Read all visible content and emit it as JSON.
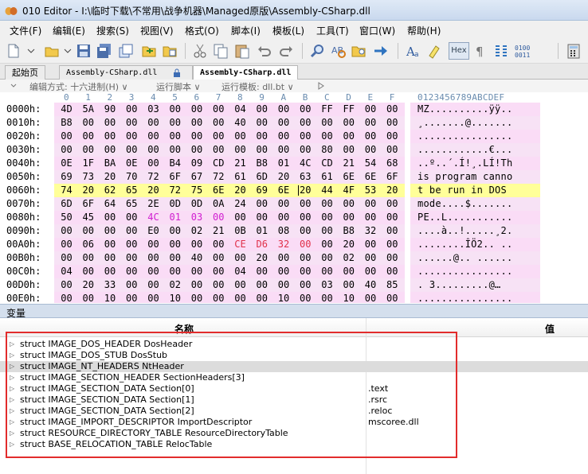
{
  "window": {
    "title": "010 Editor - I:\\临时下载\\不常用\\战争机器\\Managed原版\\Assembly-CSharp.dll"
  },
  "menu": [
    "文件(F)",
    "编辑(E)",
    "搜索(S)",
    "视图(V)",
    "格式(O)",
    "脚本(I)",
    "模板(L)",
    "工具(T)",
    "窗口(W)",
    "帮助(H)"
  ],
  "toolbar": {
    "icons": [
      "new-file-icon",
      "open-file-icon",
      "save-icon",
      "save-all-icon",
      "copy-window-icon",
      "open-folder-icon",
      "cut-icon",
      "copy-icon",
      "paste-icon",
      "undo-icon",
      "redo-icon",
      "find-icon",
      "replace-icon",
      "find-in-files-icon",
      "goto-icon",
      "font-icon",
      "highlight-icon",
      "hex-icon",
      "paragraph-icon",
      "columns-icon",
      "binary-icon",
      "calculator-icon"
    ],
    "hex_label": "Hex"
  },
  "tabs": [
    {
      "label": "起始页",
      "active": false
    },
    {
      "label": "Assembly-CSharp.dll",
      "active": false
    },
    {
      "label": "Assembly-CSharp.dll",
      "active": true
    }
  ],
  "options": {
    "edit_mode": "编辑方式: 十六进制(H) ∨",
    "run_script": "运行脚本 ∨",
    "run_template": "运行模板: dll.bt ∨"
  },
  "hex": {
    "col_labels": [
      "0",
      "1",
      "2",
      "3",
      "4",
      "5",
      "6",
      "7",
      "8",
      "9",
      "A",
      "B",
      "C",
      "D",
      "E",
      "F"
    ],
    "ascii_header": "0123456789ABCDEF",
    "rows": [
      {
        "addr": "0000h:",
        "bytes": [
          "4D",
          "5A",
          "90",
          "00",
          "03",
          "00",
          "00",
          "00",
          "04",
          "00",
          "00",
          "00",
          "FF",
          "FF",
          "00",
          "00"
        ],
        "ascii": "MZ..........ÿÿ.."
      },
      {
        "addr": "0010h:",
        "bytes": [
          "B8",
          "00",
          "00",
          "00",
          "00",
          "00",
          "00",
          "00",
          "40",
          "00",
          "00",
          "00",
          "00",
          "00",
          "00",
          "00"
        ],
        "ascii": "¸.......@......."
      },
      {
        "addr": "0020h:",
        "bytes": [
          "00",
          "00",
          "00",
          "00",
          "00",
          "00",
          "00",
          "00",
          "00",
          "00",
          "00",
          "00",
          "00",
          "00",
          "00",
          "00"
        ],
        "ascii": "................"
      },
      {
        "addr": "0030h:",
        "bytes": [
          "00",
          "00",
          "00",
          "00",
          "00",
          "00",
          "00",
          "00",
          "00",
          "00",
          "00",
          "00",
          "80",
          "00",
          "00",
          "00"
        ],
        "ascii": "............€..."
      },
      {
        "addr": "0040h:",
        "bytes": [
          "0E",
          "1F",
          "BA",
          "0E",
          "00",
          "B4",
          "09",
          "CD",
          "21",
          "B8",
          "01",
          "4C",
          "CD",
          "21",
          "54",
          "68"
        ],
        "ascii": "..º..´.Í!¸.LÍ!Th"
      },
      {
        "addr": "0050h:",
        "bytes": [
          "69",
          "73",
          "20",
          "70",
          "72",
          "6F",
          "67",
          "72",
          "61",
          "6D",
          "20",
          "63",
          "61",
          "6E",
          "6E",
          "6F"
        ],
        "ascii": "is program canno"
      },
      {
        "addr": "0060h:",
        "bytes": [
          "74",
          "20",
          "62",
          "65",
          "20",
          "72",
          "75",
          "6E",
          "20",
          "69",
          "6E",
          "20",
          "44",
          "4F",
          "53",
          "20"
        ],
        "ascii": "t be run in DOS "
      },
      {
        "addr": "0070h:",
        "bytes": [
          "6D",
          "6F",
          "64",
          "65",
          "2E",
          "0D",
          "0D",
          "0A",
          "24",
          "00",
          "00",
          "00",
          "00",
          "00",
          "00",
          "00"
        ],
        "ascii": "mode....$......."
      },
      {
        "addr": "0080h:",
        "bytes": [
          "50",
          "45",
          "00",
          "00",
          "4C",
          "01",
          "03",
          "00",
          "00",
          "00",
          "00",
          "00",
          "00",
          "00",
          "00",
          "00"
        ],
        "ascii": "PE..L..........."
      },
      {
        "addr": "0090h:",
        "bytes": [
          "00",
          "00",
          "00",
          "00",
          "E0",
          "00",
          "02",
          "21",
          "0B",
          "01",
          "08",
          "00",
          "00",
          "B8",
          "32",
          "00"
        ],
        "ascii": "....à..!.....¸2."
      },
      {
        "addr": "00A0h:",
        "bytes": [
          "00",
          "06",
          "00",
          "00",
          "00",
          "00",
          "00",
          "00",
          "CE",
          "D6",
          "32",
          "00",
          "00",
          "20",
          "00",
          "00"
        ],
        "ascii": "........ÎÖ2.. .."
      },
      {
        "addr": "00B0h:",
        "bytes": [
          "00",
          "00",
          "00",
          "00",
          "00",
          "00",
          "40",
          "00",
          "00",
          "20",
          "00",
          "00",
          "00",
          "02",
          "00",
          "00"
        ],
        "ascii": "......@.. ......"
      },
      {
        "addr": "00C0h:",
        "bytes": [
          "04",
          "00",
          "00",
          "00",
          "00",
          "00",
          "00",
          "00",
          "04",
          "00",
          "00",
          "00",
          "00",
          "00",
          "00",
          "00"
        ],
        "ascii": "................"
      },
      {
        "addr": "00D0h:",
        "bytes": [
          "00",
          "20",
          "33",
          "00",
          "00",
          "02",
          "00",
          "00",
          "00",
          "00",
          "00",
          "00",
          "03",
          "00",
          "40",
          "85"
        ],
        "ascii": ". 3.........@…"
      },
      {
        "addr": "00E0h:",
        "bytes": [
          "00",
          "00",
          "10",
          "00",
          "00",
          "10",
          "00",
          "00",
          "00",
          "00",
          "10",
          "00",
          "00",
          "10",
          "00",
          "00"
        ],
        "ascii": "................"
      }
    ]
  },
  "vars": {
    "panel_title": "变量",
    "col_name": "名称",
    "col_value": "值",
    "rows": [
      {
        "name": "struct IMAGE_DOS_HEADER DosHeader",
        "value": ""
      },
      {
        "name": "struct IMAGE_DOS_STUB DosStub",
        "value": ""
      },
      {
        "name": "struct IMAGE_NT_HEADERS NtHeader",
        "value": ""
      },
      {
        "name": "struct IMAGE_SECTION_HEADER SectionHeaders[3]",
        "value": ""
      },
      {
        "name": "struct IMAGE_SECTION_DATA Section[0]",
        "value": ".text"
      },
      {
        "name": "struct IMAGE_SECTION_DATA Section[1]",
        "value": ".rsrc"
      },
      {
        "name": "struct IMAGE_SECTION_DATA Section[2]",
        "value": ".reloc"
      },
      {
        "name": "struct IMAGE_IMPORT_DESCRIPTOR ImportDescriptor",
        "value": "mscoree.dll"
      },
      {
        "name": "struct RESOURCE_DIRECTORY_TABLE ResourceDirectoryTable",
        "value": ""
      },
      {
        "name": "struct BASE_RELOCATION_TABLE RelocTable",
        "value": ""
      }
    ]
  },
  "colors": {
    "pink_bg": "#fadcf6",
    "highlight_yellow": "#ffff99",
    "magenta": "#d020d0",
    "red_box": "#e22c2c"
  }
}
